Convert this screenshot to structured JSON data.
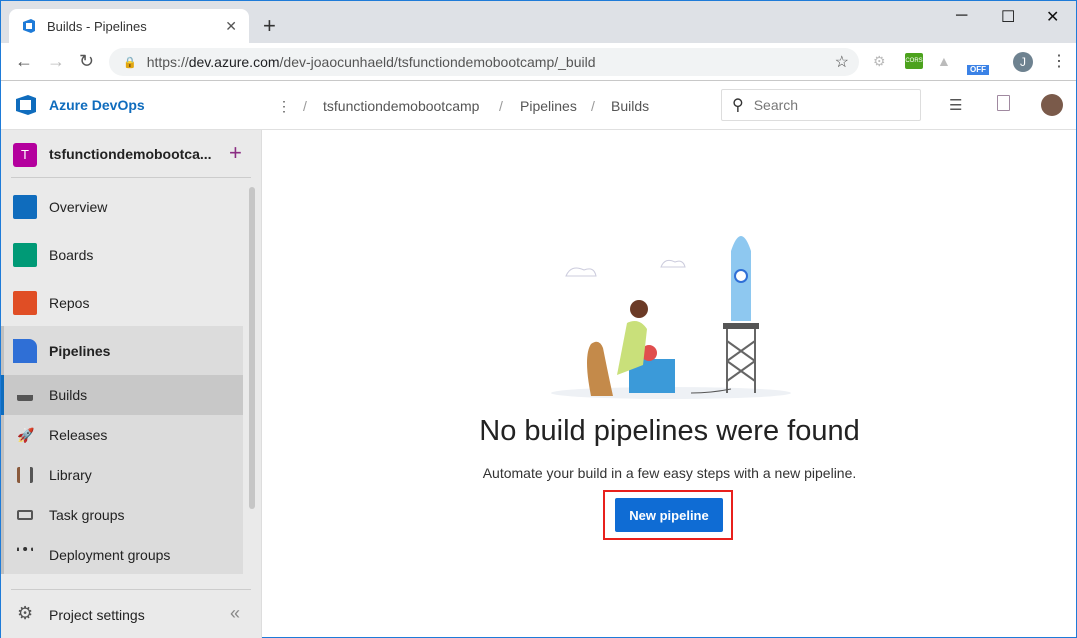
{
  "browser": {
    "tab_title": "Builds - Pipelines",
    "url_prefix": "https://",
    "url_host": "dev.azure.com",
    "url_path": "/dev-joaocunhaeld/tsfunctiondemobootcamp/_build",
    "profile_initial": "J",
    "extension_cors": "CORS",
    "extension_off": "OFF"
  },
  "header": {
    "brand": "Azure DevOps",
    "breadcrumb": [
      "tsfunctiondemobootcamp",
      "Pipelines",
      "Builds"
    ],
    "search_placeholder": "Search"
  },
  "sidebar": {
    "project_initial": "T",
    "project_name": "tsfunctiondemobootca...",
    "items": [
      {
        "label": "Overview",
        "color": "#0f6cbd"
      },
      {
        "label": "Boards",
        "color": "#009a76"
      },
      {
        "label": "Repos",
        "color": "#e04e25"
      },
      {
        "label": "Pipelines",
        "color": "#2f6fd6"
      }
    ],
    "sub_items": [
      {
        "label": "Builds"
      },
      {
        "label": "Releases"
      },
      {
        "label": "Library"
      },
      {
        "label": "Task groups"
      },
      {
        "label": "Deployment groups"
      }
    ],
    "settings": "Project settings"
  },
  "main": {
    "title": "No build pipelines were found",
    "subtitle": "Automate your build in a few easy steps with a new pipeline.",
    "button": "New pipeline",
    "accent": "#0f6cd4"
  }
}
